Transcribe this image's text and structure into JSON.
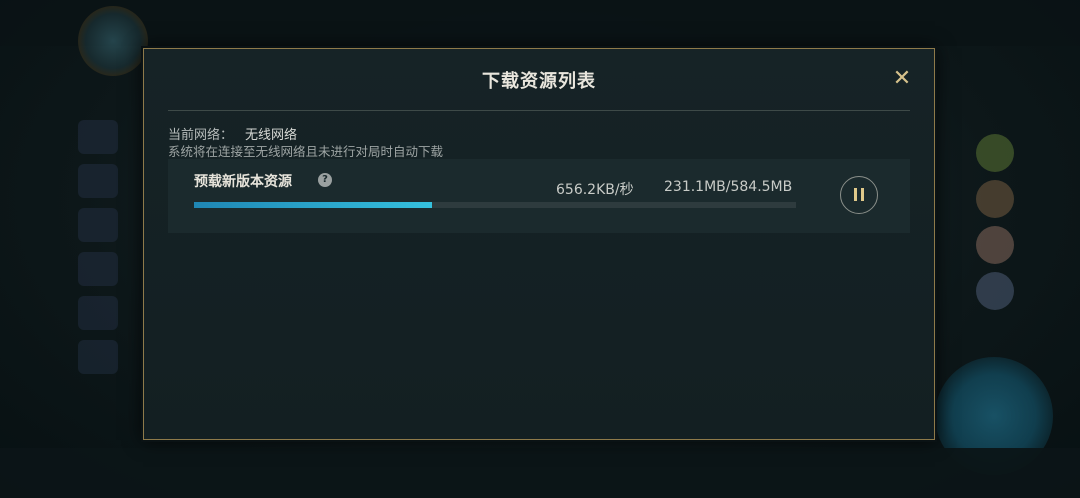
{
  "dialog": {
    "title": "下载资源列表",
    "close_icon": "close-icon",
    "network_label": "当前网络：",
    "network_value": "无线网络",
    "network_note": "系统将在连接至无线网络且未进行对局时自动下载"
  },
  "task": {
    "name": "预载新版本资源",
    "help_icon": "?",
    "speed": "656.2KB/秒",
    "size": "231.1MB/584.5MB",
    "progress_fraction": 0.395,
    "pause_icon": "pause-icon"
  },
  "colors": {
    "border_gold": "#8e7a4a",
    "progress_blue": "#35c1de",
    "accent_gold": "#d6c28c"
  }
}
